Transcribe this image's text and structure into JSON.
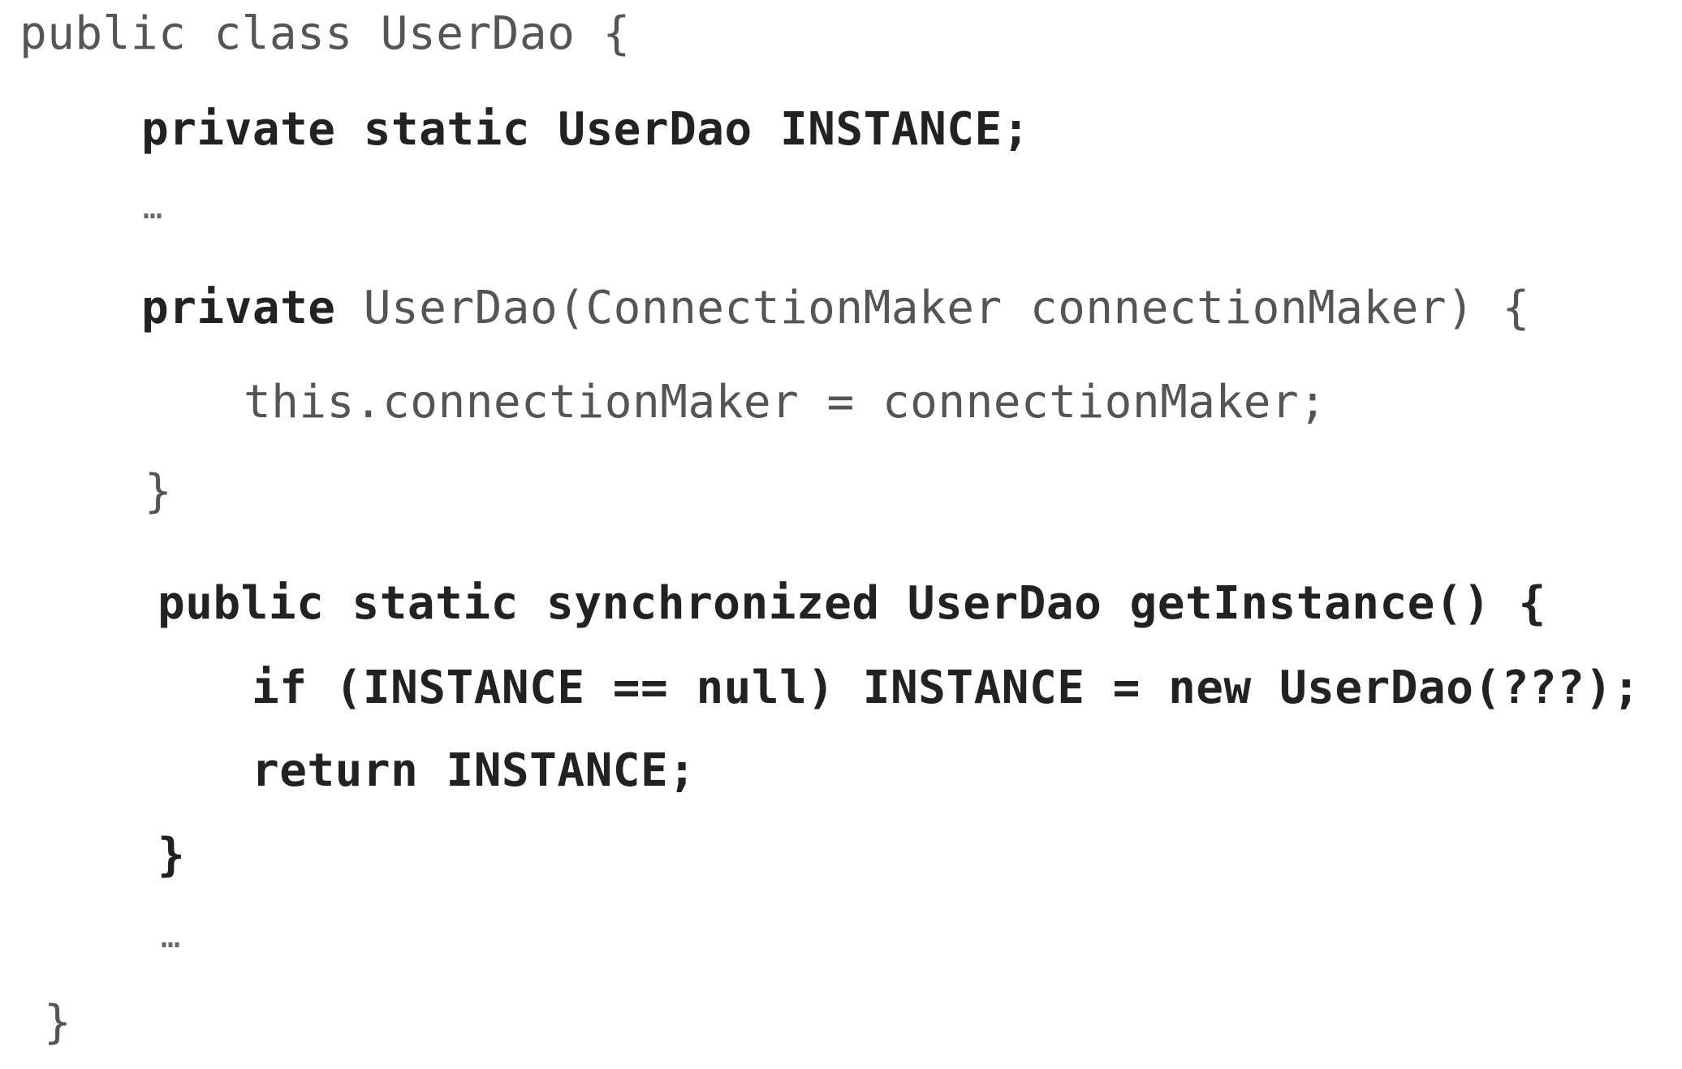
{
  "code": {
    "line1": "public class UserDao {",
    "line2": "private static UserDao INSTANCE;",
    "line3": "…",
    "line4_keyword": "private",
    "line4_rest": " UserDao(ConnectionMaker connectionMaker) {",
    "line5": "this.connectionMaker = connectionMaker;",
    "line6": "}",
    "line7": "public static synchronized UserDao getInstance() {",
    "line8": "if (INSTANCE == null) INSTANCE = new UserDao(???);",
    "line9": "return INSTANCE;",
    "line10": "}",
    "line11": "…",
    "line12": "}"
  }
}
